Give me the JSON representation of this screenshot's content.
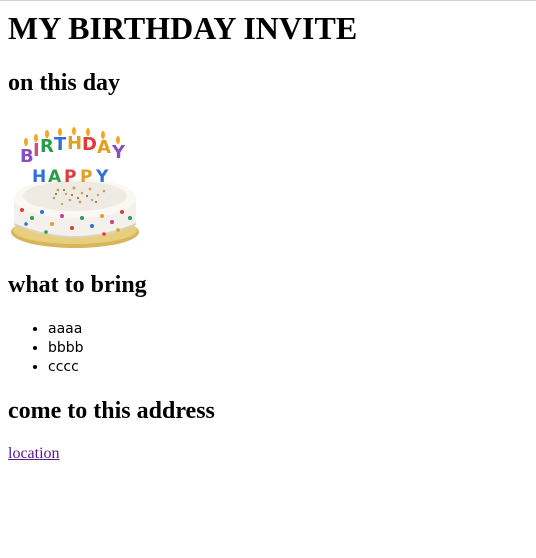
{
  "page": {
    "title": "MY BIRTHDAY INVITE",
    "day_heading": "on this day",
    "bring_heading": "what to bring",
    "address_heading": "come to this address"
  },
  "cake_image": {
    "description_icon": "birthday-cake",
    "letters_top": [
      "B",
      "I",
      "R",
      "T",
      "H",
      "D",
      "A",
      "Y"
    ],
    "letters_bottom": [
      "H",
      "A",
      "P",
      "P",
      "Y"
    ]
  },
  "bring_list": {
    "items": [
      "aaaa",
      "bbbb",
      "cccc"
    ]
  },
  "address": {
    "link_label": "location",
    "link_color": "#551a8b"
  }
}
